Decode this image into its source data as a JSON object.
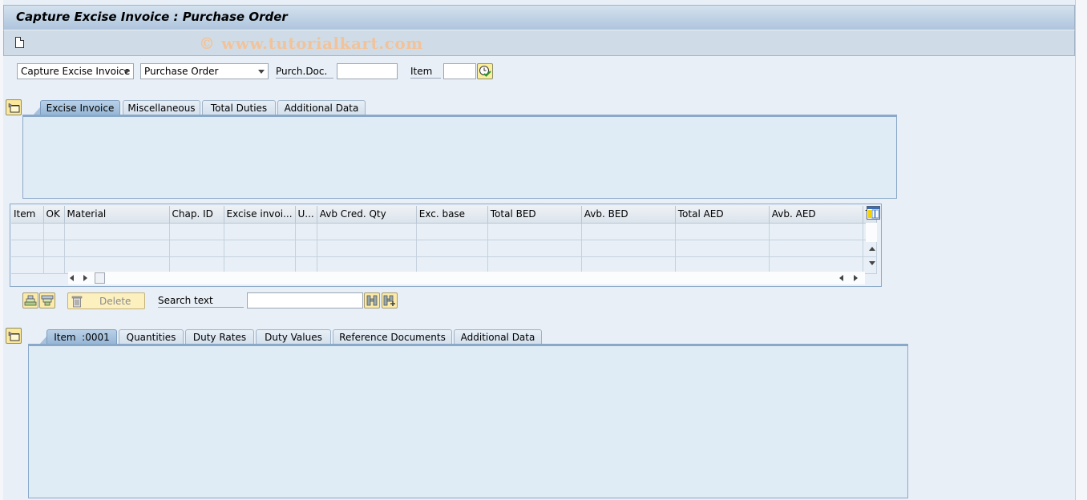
{
  "window": {
    "title": "Capture Excise Invoice : Purchase Order",
    "watermark": "© www.tutorialkart.com"
  },
  "toolbar": {
    "icons": [
      "new-document-icon"
    ]
  },
  "selection": {
    "action_combo": {
      "value": "Capture Excise Invoice",
      "icon": "chevron-down-icon"
    },
    "reference_combo": {
      "value": "Purchase Order",
      "icon": "chevron-down-icon"
    },
    "purch_doc": {
      "label": "Purch.Doc.",
      "value": ""
    },
    "item": {
      "label": "Item",
      "value": ""
    },
    "execute_icon": "clock-check-icon"
  },
  "header_tabs": {
    "tabs": [
      {
        "label": "Excise Invoice",
        "active": true
      },
      {
        "label": "Miscellaneous",
        "active": false
      },
      {
        "label": "Total Duties",
        "active": false
      },
      {
        "label": "Additional Data",
        "active": false
      }
    ]
  },
  "items_grid": {
    "columns": [
      "Item",
      "OK",
      "Material",
      "Chap. ID",
      "Excise invoi...",
      "U...",
      "Avb Cred. Qty",
      "Exc. base",
      "Total BED",
      "Avb. BED",
      "Total AED",
      "Avb. AED",
      "T"
    ],
    "rows": [
      [
        "",
        "",
        "",
        "",
        "",
        "",
        "",
        "",
        "",
        "",
        "",
        "",
        ""
      ],
      [
        "",
        "",
        "",
        "",
        "",
        "",
        "",
        "",
        "",
        "",
        "",
        "",
        ""
      ],
      [
        "",
        "",
        "",
        "",
        "",
        "",
        "",
        "",
        "",
        "",
        "",
        "",
        ""
      ]
    ]
  },
  "grid_toolbar": {
    "select_all_icon": "select-all-icon",
    "deselect_all_icon": "deselect-all-icon",
    "delete_label": "Delete",
    "search_label": "Search text",
    "search_value": "",
    "find_icon": "binoculars-icon",
    "find_next_icon": "binoculars-plus-icon"
  },
  "item_tabs": {
    "tabs": [
      {
        "label": "Item  :0001",
        "active": true
      },
      {
        "label": "Quantities",
        "active": false
      },
      {
        "label": "Duty Rates",
        "active": false
      },
      {
        "label": "Duty Values",
        "active": false
      },
      {
        "label": "Reference Documents",
        "active": false
      },
      {
        "label": "Additional Data",
        "active": false
      }
    ]
  },
  "colors": {
    "title_bar": "#aec5dd",
    "toolbar": "#cfdce7",
    "background": "#e8eff7",
    "active_tab": "#93b4d5",
    "panel": "#dfebf5",
    "watermark": "#f2c39a",
    "button_yellow": "#fbe89b"
  }
}
